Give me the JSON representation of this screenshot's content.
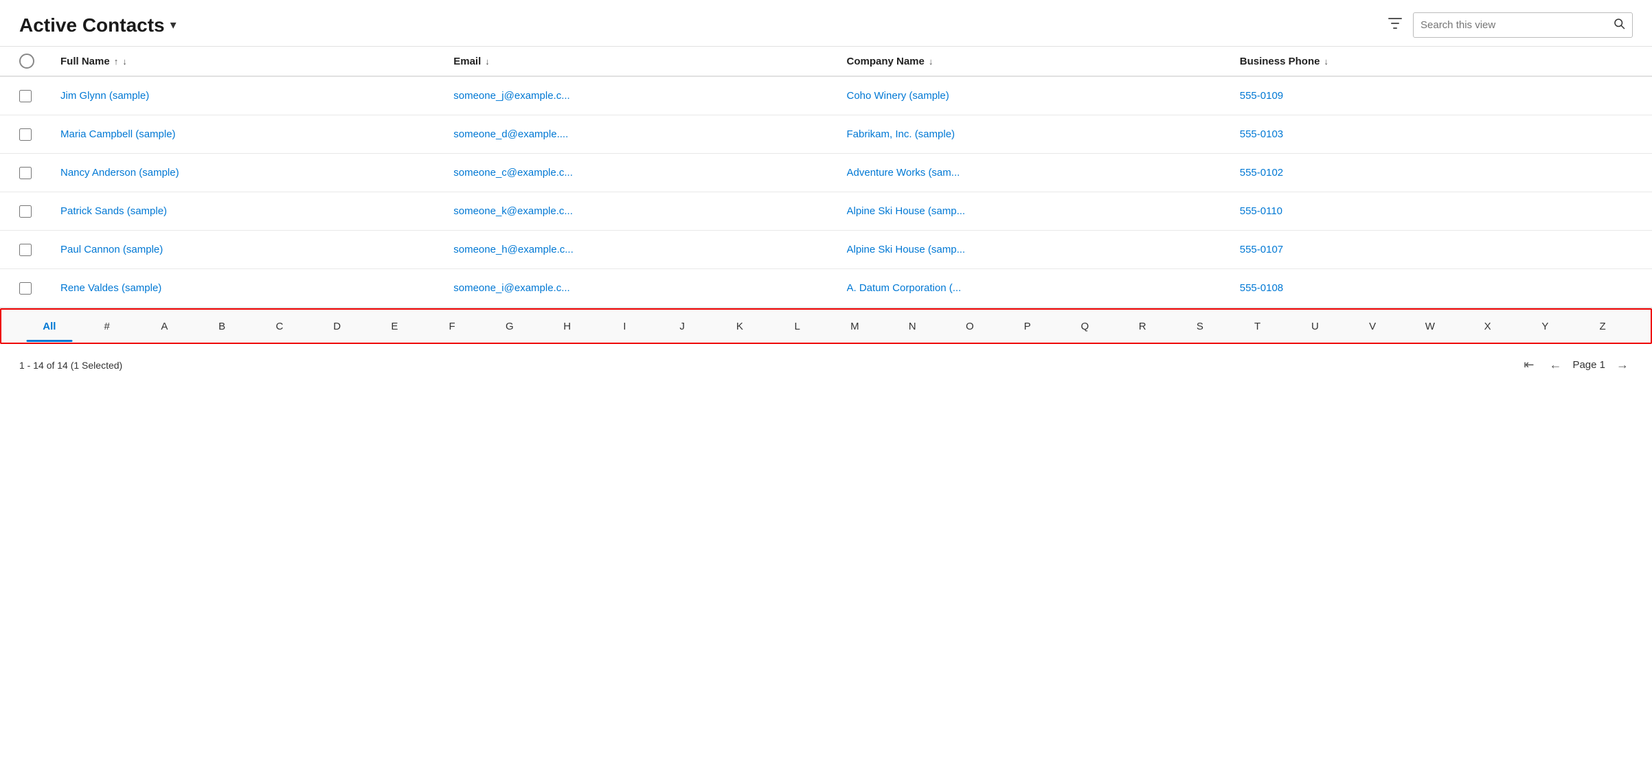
{
  "header": {
    "title": "Active Contacts",
    "chevron": "▾",
    "filter_icon": "⛉",
    "search_placeholder": "Search this view",
    "search_icon": "🔍"
  },
  "table": {
    "columns": [
      {
        "key": "checkbox",
        "label": ""
      },
      {
        "key": "full_name",
        "label": "Full Name",
        "sortable": true
      },
      {
        "key": "email",
        "label": "Email",
        "sortable": true
      },
      {
        "key": "company_name",
        "label": "Company Name",
        "sortable": true
      },
      {
        "key": "business_phone",
        "label": "Business Phone",
        "sortable": true
      }
    ],
    "rows": [
      {
        "full_name": "Jim Glynn (sample)",
        "email": "someone_j@example.c...",
        "company_name": "Coho Winery (sample)",
        "business_phone": "555-0109"
      },
      {
        "full_name": "Maria Campbell (sample)",
        "email": "someone_d@example....",
        "company_name": "Fabrikam, Inc. (sample)",
        "business_phone": "555-0103"
      },
      {
        "full_name": "Nancy Anderson (sample)",
        "email": "someone_c@example.c...",
        "company_name": "Adventure Works (sam...",
        "business_phone": "555-0102"
      },
      {
        "full_name": "Patrick Sands (sample)",
        "email": "someone_k@example.c...",
        "company_name": "Alpine Ski House (samp...",
        "business_phone": "555-0110"
      },
      {
        "full_name": "Paul Cannon (sample)",
        "email": "someone_h@example.c...",
        "company_name": "Alpine Ski House (samp...",
        "business_phone": "555-0107"
      },
      {
        "full_name": "Rene Valdes (sample)",
        "email": "someone_i@example.c...",
        "company_name": "A. Datum Corporation (...",
        "business_phone": "555-0108"
      }
    ]
  },
  "alpha_nav": {
    "items": [
      "All",
      "#",
      "A",
      "B",
      "C",
      "D",
      "E",
      "F",
      "G",
      "H",
      "I",
      "J",
      "K",
      "L",
      "M",
      "N",
      "O",
      "P",
      "Q",
      "R",
      "S",
      "T",
      "U",
      "V",
      "W",
      "X",
      "Y",
      "Z"
    ],
    "active": "All"
  },
  "footer": {
    "record_info": "1 - 14 of 14 (1 Selected)",
    "page_label": "Page 1"
  }
}
